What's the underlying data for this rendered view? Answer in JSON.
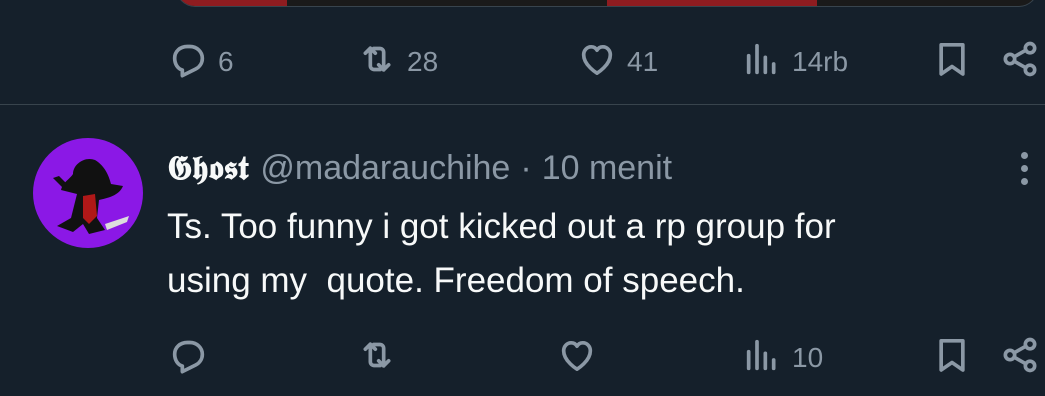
{
  "prev_tweet": {
    "actions": {
      "reply": {
        "icon": "reply-icon",
        "count": "6"
      },
      "retweet": {
        "icon": "retweet-icon",
        "count": "28"
      },
      "like": {
        "icon": "heart-icon",
        "count": "41"
      },
      "views": {
        "icon": "views-icon",
        "count": "14rb"
      },
      "bookmark": {
        "icon": "bookmark-icon"
      },
      "share": {
        "icon": "share-icon"
      }
    }
  },
  "tweet": {
    "display_name": "𝕲𝖍𝖔𝖘𝖙",
    "handle": "@madarauchihe",
    "separator": "·",
    "time": "10 menit",
    "text": "Ts. Too funny i got kicked out a rp group for\nusing my  quote. Freedom of speech.",
    "actions": {
      "reply": {
        "icon": "reply-icon",
        "count": ""
      },
      "retweet": {
        "icon": "retweet-icon",
        "count": ""
      },
      "like": {
        "icon": "heart-icon",
        "count": ""
      },
      "views": {
        "icon": "views-icon",
        "count": "10"
      },
      "bookmark": {
        "icon": "bookmark-icon"
      },
      "share": {
        "icon": "share-icon"
      }
    }
  },
  "colors": {
    "background": "#15202b",
    "text_primary": "#f7f9f9",
    "text_secondary": "#8b98a5",
    "avatar_bg": "#8b18e6",
    "divider": "#38444d"
  }
}
